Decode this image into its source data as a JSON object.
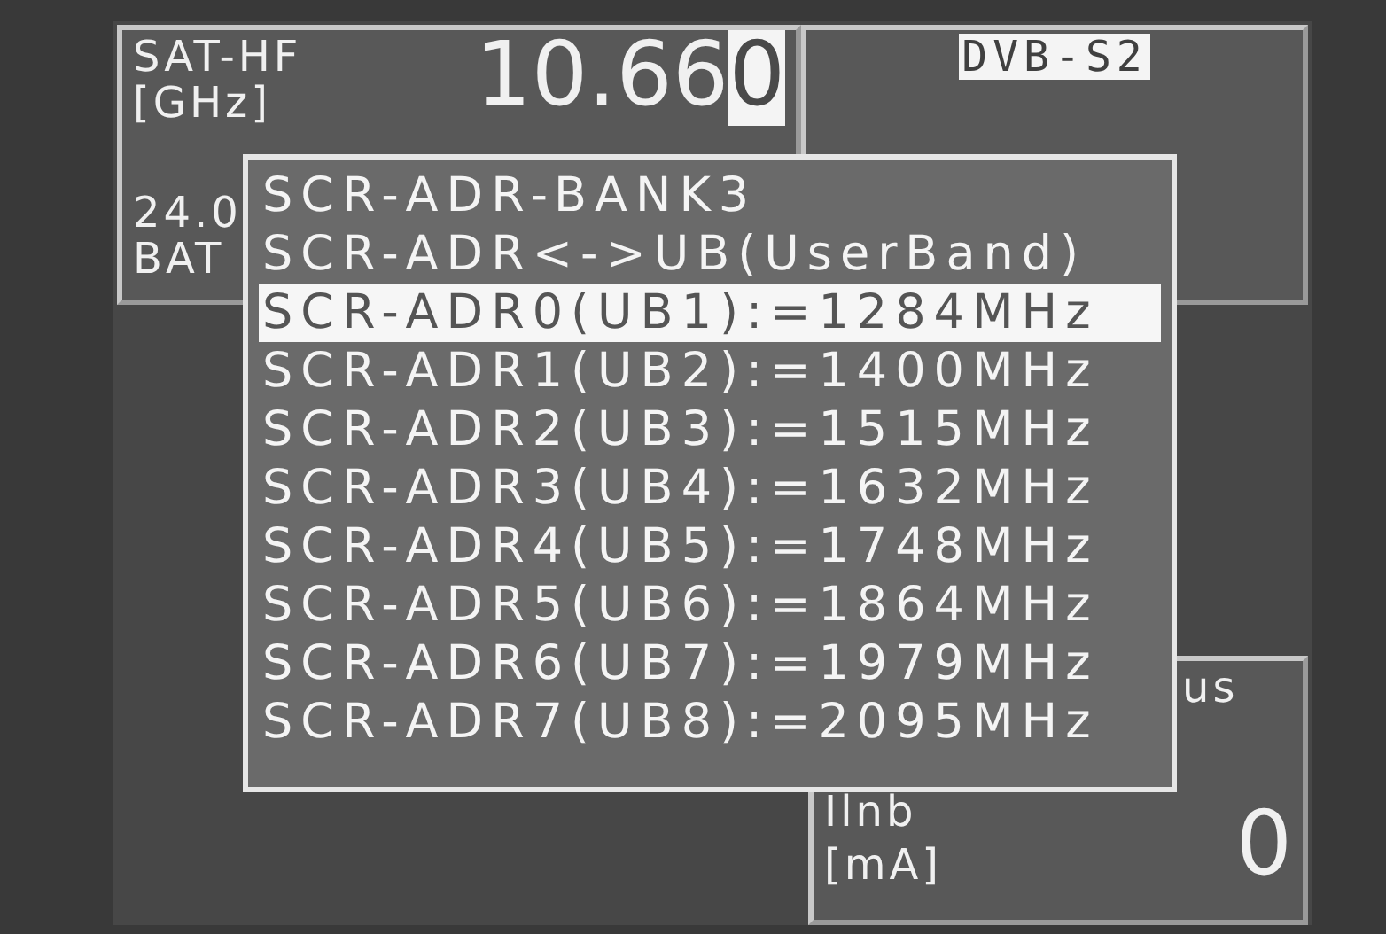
{
  "frequency_panel": {
    "label": "SAT-HF",
    "unit": "[GHz]",
    "value_prefix": "10.66",
    "cursor_digit": "0",
    "line_3": "24.0",
    "line_4": "BAT"
  },
  "standard_panel": {
    "label": "DVB-S2",
    "highlighted": true
  },
  "lnb_panel": {
    "header": "us",
    "label": "Ilnb",
    "unit": "[mA]",
    "value": "0"
  },
  "popup": {
    "title": "SCR-ADR-BANK3",
    "subtitle": "SCR-ADR<->UB(UserBand)",
    "items": [
      {
        "label": "SCR-ADR0(UB1):=1284MHz",
        "selected": true
      },
      {
        "label": "SCR-ADR1(UB2):=1400MHz",
        "selected": false
      },
      {
        "label": "SCR-ADR2(UB3):=1515MHz",
        "selected": false
      },
      {
        "label": "SCR-ADR3(UB4):=1632MHz",
        "selected": false
      },
      {
        "label": "SCR-ADR4(UB5):=1748MHz",
        "selected": false
      },
      {
        "label": "SCR-ADR5(UB6):=1864MHz",
        "selected": false
      },
      {
        "label": "SCR-ADR6(UB7):=1979MHz",
        "selected": false
      },
      {
        "label": "SCR-ADR7(UB8):=2095MHz",
        "selected": false
      }
    ]
  }
}
